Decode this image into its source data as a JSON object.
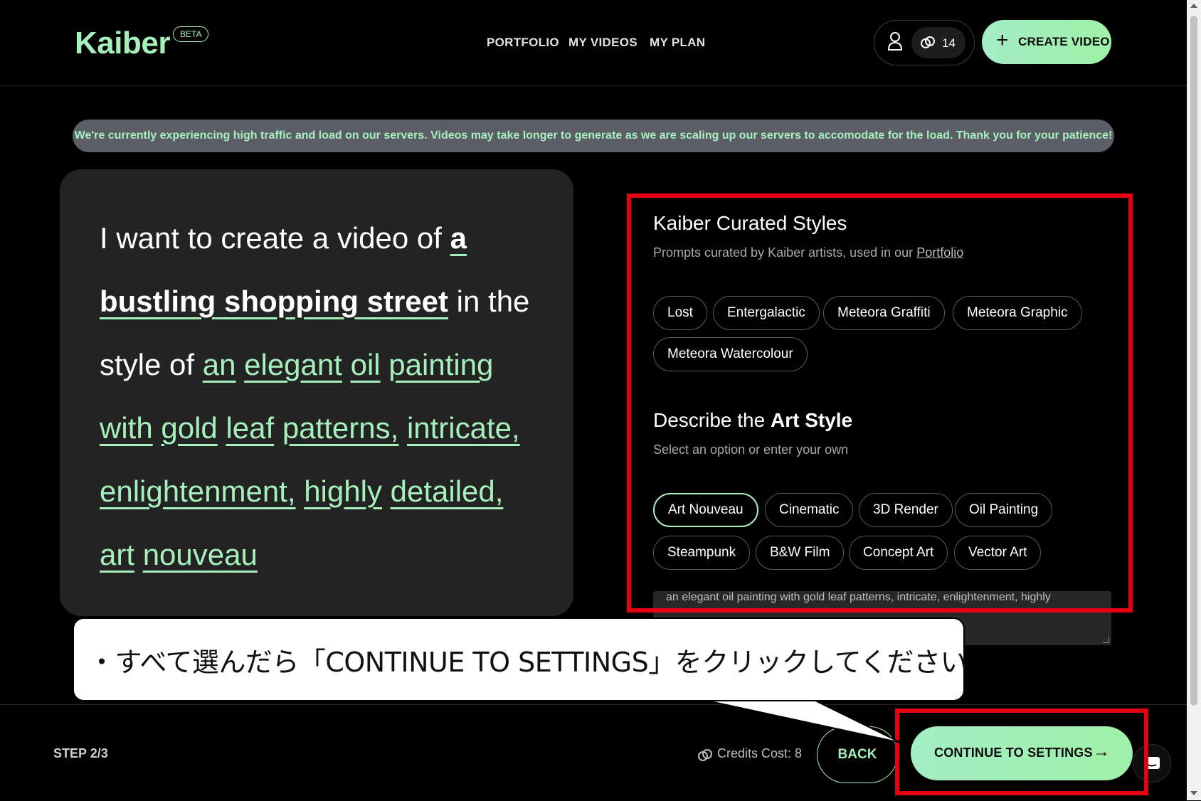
{
  "header": {
    "logo": "Kaiber",
    "beta_badge": "BETA",
    "nav": [
      "PORTFOLIO",
      "MY VIDEOS",
      "MY PLAN"
    ],
    "credits": "14",
    "create_label": "CREATE VIDEO"
  },
  "banner": {
    "text": "We're currently experiencing high traffic and load on our servers. Videos may take longer to generate as we are scaling up our servers to accomodate for the load. Thank you for your patience!"
  },
  "prompt": {
    "lead": "I want to create a video of",
    "article": "a",
    "subject": "bustling shopping street",
    "mid": "in the style of",
    "style_words": [
      "an",
      "elegant",
      "oil",
      "painting",
      "with",
      "gold",
      "leaf",
      "patterns,",
      "intricate,",
      "enlightenment,",
      "highly",
      "detailed,",
      "art",
      "nouveau"
    ]
  },
  "curated": {
    "title": "Kaiber Curated Styles",
    "subtitle_prefix": "Prompts curated by Kaiber artists, used in our",
    "subtitle_link": "Portfolio",
    "chips": [
      "Lost",
      "Entergalactic",
      "Meteora Graffiti",
      "Meteora Graphic",
      "Meteora Watercolour"
    ]
  },
  "art_style": {
    "title_prefix": "Describe the",
    "title_bold": "Art Style",
    "subtitle": "Select an option or enter your own",
    "chips": [
      "Art Nouveau",
      "Cinematic",
      "3D Render",
      "Oil Painting",
      "Steampunk",
      "B&W Film",
      "Concept Art",
      "Vector Art"
    ],
    "selected": "Art Nouveau",
    "textarea_value": "an elegant oil painting with gold leaf patterns, intricate, enlightenment, highly"
  },
  "footer": {
    "step": "STEP 2/3",
    "cost": "Credits Cost: 8",
    "back": "BACK",
    "continue": "CONTINUE TO SETTINGS"
  },
  "callout": {
    "text": "・すべて選んだら「CONTINUE TO SETTINGS」をクリックしてください"
  },
  "colors": {
    "accent": "#a6f0bb",
    "annotation_red": "#e60012",
    "banner_bg": "#5b5e67"
  }
}
